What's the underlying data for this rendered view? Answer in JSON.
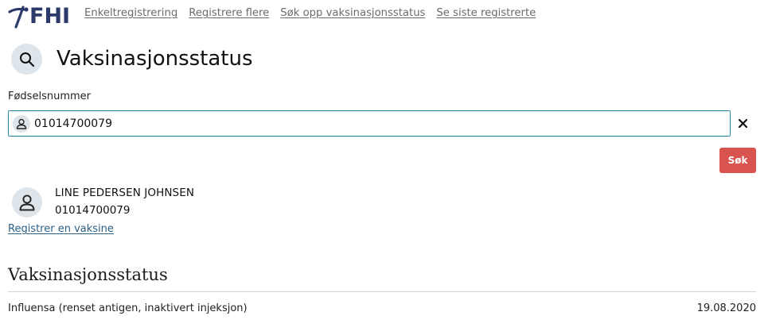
{
  "header": {
    "logo_text": "FHI",
    "nav": [
      {
        "label": "Enkeltregistrering"
      },
      {
        "label": "Registrere flere"
      },
      {
        "label": "Søk opp vaksinasjonsstatus"
      },
      {
        "label": "Se siste registrerte"
      }
    ]
  },
  "page": {
    "title": "Vaksinasjonsstatus"
  },
  "search": {
    "field_label": "Fødselsnummer",
    "value": "01014700079",
    "button_label": "Søk"
  },
  "person": {
    "name": "LINE PEDERSEN JOHNSEN",
    "id": "01014700079",
    "register_link": "Registrer en vaksine"
  },
  "status": {
    "title": "Vaksinasjonsstatus",
    "items": [
      {
        "vaccine": "Influensa (renset antigen, inaktivert injeksjon)",
        "date": "19.08.2020"
      }
    ]
  },
  "colors": {
    "brand": "#2b3a6b",
    "accent_border": "#2d86a8",
    "search_button": "#d9534f",
    "link": "#2a5f86",
    "icon_bg": "#dde4ea"
  },
  "icons": {
    "logo": "fhi-logo-icon",
    "search": "search-icon",
    "user": "user-icon",
    "clear": "close-icon"
  }
}
